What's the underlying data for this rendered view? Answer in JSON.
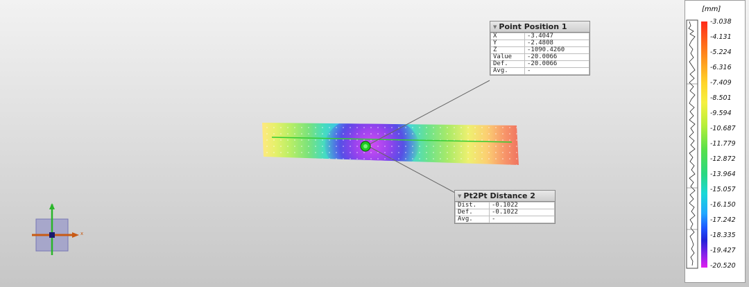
{
  "point_panel": {
    "title": "Point Position 1",
    "rows": [
      {
        "label": "X",
        "value": "-3.4047"
      },
      {
        "label": "Y",
        "value": "-2.4808"
      },
      {
        "label": "Z",
        "value": "-1090.4260"
      },
      {
        "label": "Value",
        "value": "-20.0066"
      },
      {
        "label": "Def.",
        "value": "-20.0066"
      },
      {
        "label": "Avg.",
        "value": "-"
      }
    ]
  },
  "distance_panel": {
    "title": "Pt2Pt Distance 2",
    "rows": [
      {
        "label": "Dist.",
        "value": "-0.1022"
      },
      {
        "label": "Def.",
        "value": "-0.1022"
      },
      {
        "label": "Avg.",
        "value": "-"
      }
    ]
  },
  "axes": {
    "x_label": "x",
    "y_label": "y"
  },
  "legend": {
    "unit": "[mm]",
    "ticks": [
      "-3.038",
      "-4.131",
      "-5.224",
      "-6.316",
      "-7.409",
      "-8.501",
      "-9.594",
      "-10.687",
      "-11.779",
      "-12.872",
      "-13.964",
      "-15.057",
      "-16.150",
      "-17.242",
      "-18.335",
      "-19.427",
      "-20.520"
    ]
  },
  "colors": {
    "marker": "#22cc22",
    "leader_line": "#666666",
    "axis_x": "#c85a14",
    "axis_y": "#2ab52a",
    "axis_box": "#8c8cc8"
  }
}
